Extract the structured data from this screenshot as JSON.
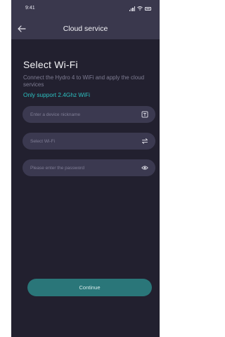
{
  "status_bar": {
    "time": "9:41"
  },
  "nav": {
    "title": "Cloud service"
  },
  "content": {
    "heading": "Select Wi-Fi",
    "description": "Connect the Hydro 4 to WiFi and apply the cloud services",
    "note": "Only support 2.4Ghz WiFi"
  },
  "fields": {
    "nickname_placeholder": "Enter a device nickname",
    "wifi_placeholder": "Select Wi-Fi",
    "password_placeholder": "Please enter the password"
  },
  "continue_label": "Continue",
  "icons": {
    "back": "arrow-left-icon",
    "nickname": "tag-icon",
    "wifi": "swap-arrows-icon",
    "password": "eye-icon"
  },
  "colors": {
    "background": "#22202f",
    "header": "#3a384d",
    "field": "#3b3950",
    "accent": "#2cc1c1",
    "button": "#2a7679"
  }
}
